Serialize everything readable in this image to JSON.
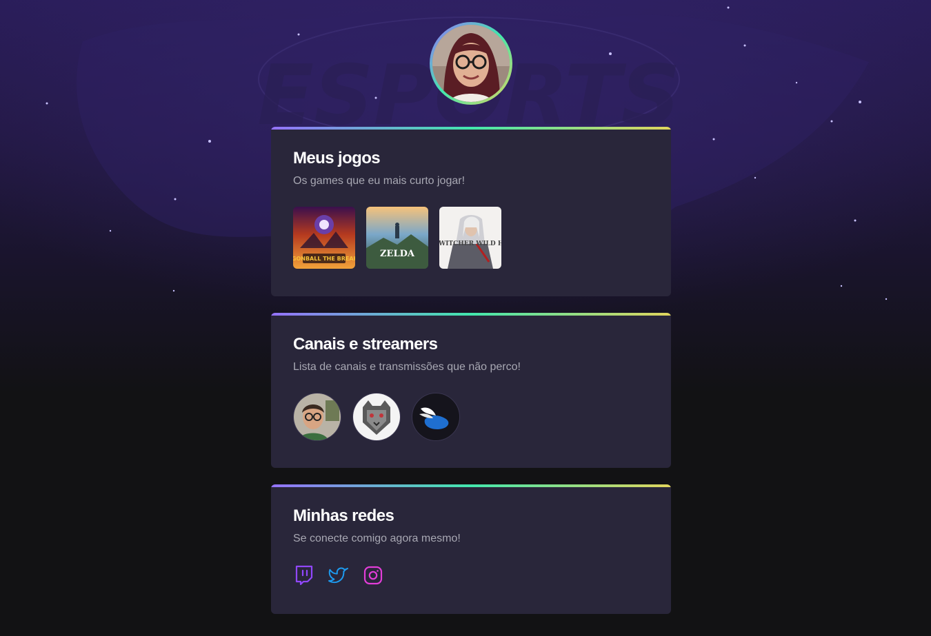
{
  "profile": {
    "avatar_alt": "Foto de perfil"
  },
  "sections": {
    "games": {
      "title": "Meus jogos",
      "subtitle": "Os games que eu mais curto jogar!",
      "items": [
        {
          "label": "DRAGONBALL THE BREAKERS",
          "icon": "dragonball-game-cover"
        },
        {
          "label": "ZELDA",
          "icon": "zelda-game-cover"
        },
        {
          "label": "THE WITCHER WILD HUNT",
          "icon": "witcher-game-cover"
        }
      ]
    },
    "channels": {
      "title": "Canais e streamers",
      "subtitle": "Lista de canais e transmissões que não perco!",
      "items": [
        {
          "icon": "streamer-boy-avatar"
        },
        {
          "icon": "tiger-logo-avatar"
        },
        {
          "icon": "winged-shoe-logo-avatar"
        }
      ]
    },
    "social": {
      "title": "Minhas redes",
      "subtitle": "Se conecte comigo agora mesmo!",
      "items": [
        {
          "icon": "twitch-icon",
          "color": "#9147ff"
        },
        {
          "icon": "twitter-icon",
          "color": "#1d9bf0"
        },
        {
          "icon": "instagram-icon",
          "color": "#e23dd8"
        }
      ]
    }
  },
  "theme": {
    "card_bg": "#29263a",
    "gradient": [
      "#9572fc",
      "#43e7ad",
      "#e1d55d"
    ],
    "title_color": "#ffffff",
    "subtitle_color": "#a8a8b3"
  }
}
